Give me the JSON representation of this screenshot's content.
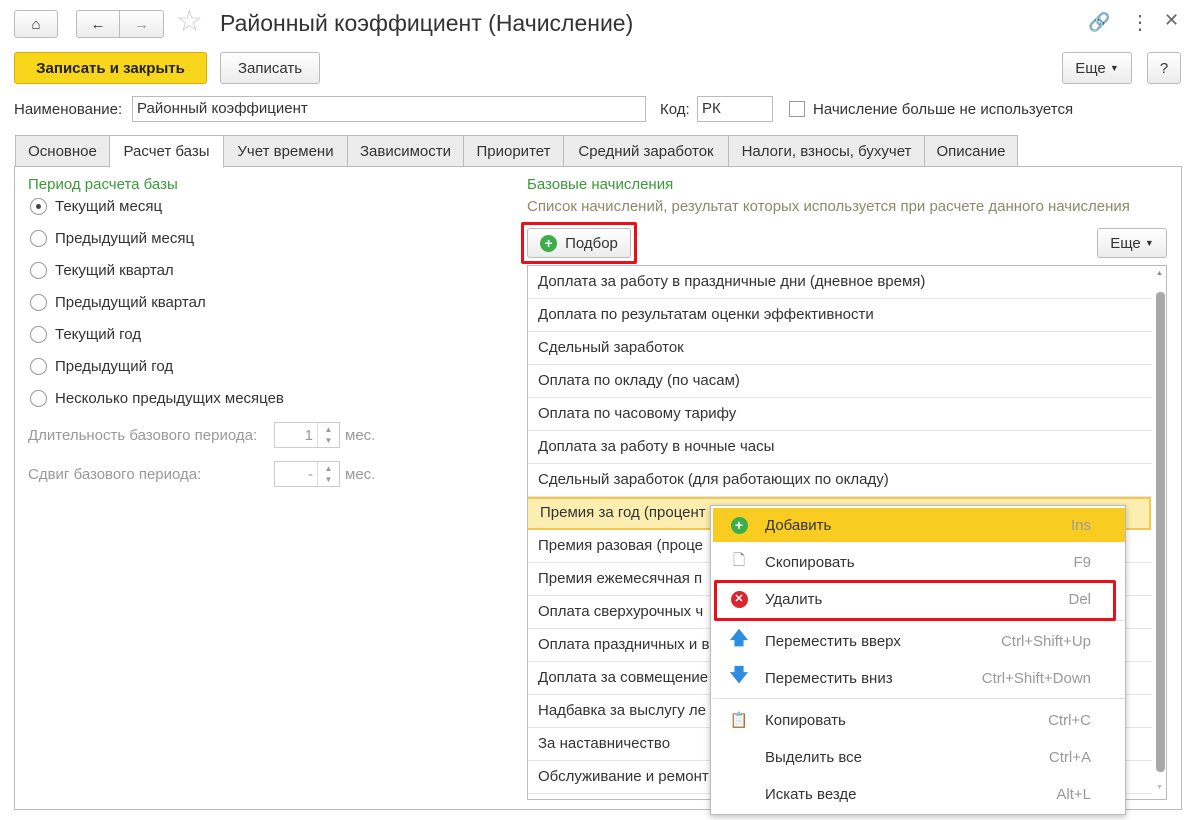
{
  "window": {
    "title": "Районный коэффициент (Начисление)"
  },
  "toolbar": {
    "save_close": "Записать и закрыть",
    "save": "Записать",
    "more": "Еще",
    "help": "?"
  },
  "form": {
    "name_label": "Наименование:",
    "name_value": "Районный коэффициент",
    "code_label": "Код:",
    "code_value": "РК",
    "unused_label": "Начисление больше не используется"
  },
  "tabs": [
    "Основное",
    "Расчет базы",
    "Учет времени",
    "Зависимости",
    "Приоритет",
    "Средний заработок",
    "Налоги, взносы, бухучет",
    "Описание"
  ],
  "period": {
    "title": "Период расчета базы",
    "options": [
      "Текущий месяц",
      "Предыдущий месяц",
      "Текущий квартал",
      "Предыдущий квартал",
      "Текущий год",
      "Предыдущий год",
      "Несколько предыдущих месяцев"
    ],
    "duration_label": "Длительность базового периода:",
    "duration_value": "1",
    "shift_label": "Сдвиг базового периода:",
    "shift_value": "-",
    "unit": "мес."
  },
  "base": {
    "title": "Базовые начисления",
    "subtitle": "Список начислений, результат которых используется при расчете данного начисления",
    "pick": "Подбор",
    "more": "Еще",
    "items": [
      "Доплата за работу в праздничные дни (дневное время)",
      "Доплата по результатам оценки эффективности",
      "Сдельный заработок",
      "Оплата по окладу (по часам)",
      "Оплата по часовому тарифу",
      "Доплата за работу в ночные часы",
      "Сдельный заработок (для работающих по окладу)",
      "Премия за год (процент",
      "Премия разовая (проце",
      "Премия ежемесячная п",
      "Оплата сверхурочных ч",
      "Оплата праздничных и в",
      "Доплата за совмещение",
      "Надбавка за выслугу ле",
      "За наставничество",
      "Обслуживание и ремонт"
    ]
  },
  "menu": [
    {
      "label": "Добавить",
      "shortcut": "Ins"
    },
    {
      "label": "Скопировать",
      "shortcut": "F9"
    },
    {
      "label": "Удалить",
      "shortcut": "Del"
    },
    {
      "label": "Переместить вверх",
      "shortcut": "Ctrl+Shift+Up"
    },
    {
      "label": "Переместить вниз",
      "shortcut": "Ctrl+Shift+Down"
    },
    {
      "label": "Копировать",
      "shortcut": "Ctrl+C"
    },
    {
      "label": "Выделить все",
      "shortcut": "Ctrl+A"
    },
    {
      "label": "Искать везде",
      "shortcut": "Alt+L"
    }
  ],
  "colors": {
    "accent_yellow": "#f9cc22",
    "highlight_red": "#e8111b",
    "section_green": "#3a9a3a"
  }
}
